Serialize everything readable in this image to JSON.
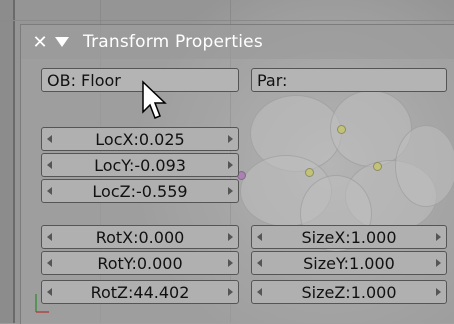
{
  "panel": {
    "title": "Transform Properties",
    "ob_field": "OB: Floor",
    "par_field": "Par:"
  },
  "location": [
    {
      "label": "LocX:",
      "value": "0.025"
    },
    {
      "label": "LocY:",
      "value": "-0.093"
    },
    {
      "label": "LocZ:",
      "value": "-0.559"
    }
  ],
  "rotation": [
    {
      "label": "RotX:",
      "value": "0.000"
    },
    {
      "label": "RotY:",
      "value": "0.000"
    },
    {
      "label": "RotZ:",
      "value": "44.402"
    }
  ],
  "size": [
    {
      "label": "SizeX:",
      "value": "1.000"
    },
    {
      "label": "SizeY:",
      "value": "1.000"
    },
    {
      "label": "SizeZ:",
      "value": "1.000"
    }
  ],
  "icons": {
    "close": "close-icon",
    "collapse": "triangle-down-icon",
    "cursor": "mouse-pointer-icon"
  },
  "colors": {
    "panel_text": "#ffffff",
    "field_bg": "#b0b0b0",
    "vertex_dot": "#e6e640"
  }
}
